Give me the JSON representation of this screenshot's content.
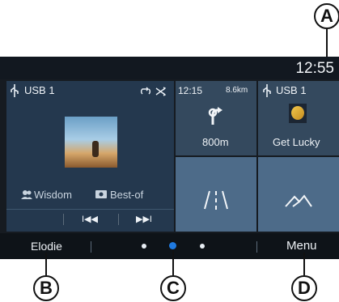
{
  "callouts": {
    "a": "A",
    "b": "B",
    "c": "C",
    "d": "D"
  },
  "status": {
    "time": "12:55"
  },
  "music": {
    "source": "USB 1",
    "artist": "Wisdom",
    "album": "Best-of",
    "controls": {
      "prev": "I◀◀",
      "next": "▶▶I"
    }
  },
  "nav": {
    "time": "12:15",
    "distance": "8.6km",
    "turn_distance": "800m"
  },
  "usb_tile": {
    "source": "USB 1",
    "track": "Get Lucky"
  },
  "bottom": {
    "left_label": "Elodie",
    "right_label": "Menu"
  },
  "colors": {
    "accent": "#1f7ae0",
    "panel": "#24384e",
    "tile_dark": "#34495e",
    "tile_light": "#4d6b89"
  }
}
